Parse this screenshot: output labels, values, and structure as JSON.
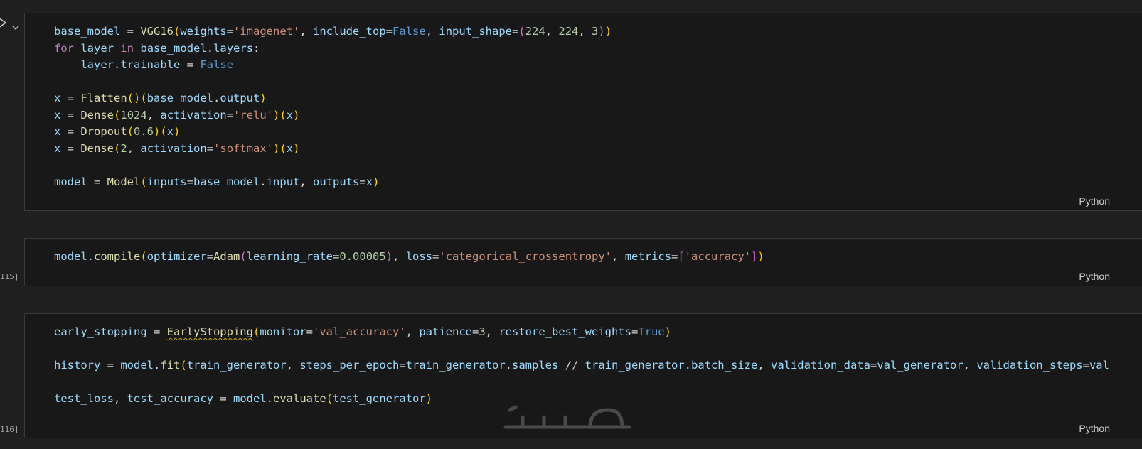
{
  "cells": [
    {
      "exec_count": "",
      "language": "Python",
      "lines": [
        [
          [
            "v",
            "base_model"
          ],
          [
            "o",
            " = "
          ],
          [
            "f",
            "VGG16"
          ],
          [
            "p1",
            "("
          ],
          [
            "v",
            "weights"
          ],
          [
            "o",
            "="
          ],
          [
            "s",
            "'imagenet'"
          ],
          [
            "o",
            ", "
          ],
          [
            "v",
            "include_top"
          ],
          [
            "o",
            "="
          ],
          [
            "b",
            "False"
          ],
          [
            "o",
            ", "
          ],
          [
            "v",
            "input_shape"
          ],
          [
            "o",
            "="
          ],
          [
            "p2",
            "("
          ],
          [
            "n",
            "224"
          ],
          [
            "o",
            ", "
          ],
          [
            "n",
            "224"
          ],
          [
            "o",
            ", "
          ],
          [
            "n",
            "3"
          ],
          [
            "p2",
            ")"
          ],
          [
            "p1",
            ")"
          ]
        ],
        [
          [
            "k",
            "for"
          ],
          [
            "o",
            " "
          ],
          [
            "v",
            "layer"
          ],
          [
            "o",
            " "
          ],
          [
            "k",
            "in"
          ],
          [
            "o",
            " "
          ],
          [
            "v",
            "base_model"
          ],
          [
            "o",
            "."
          ],
          [
            "v",
            "layers"
          ],
          [
            "o",
            ":"
          ]
        ],
        [
          [
            "o",
            "    "
          ],
          [
            "v",
            "layer"
          ],
          [
            "o",
            "."
          ],
          [
            "v",
            "trainable"
          ],
          [
            "o",
            " = "
          ],
          [
            "b",
            "False"
          ]
        ],
        [],
        [
          [
            "v",
            "x"
          ],
          [
            "o",
            " = "
          ],
          [
            "f",
            "Flatten"
          ],
          [
            "p1",
            "()"
          ],
          [
            "p1",
            "("
          ],
          [
            "v",
            "base_model"
          ],
          [
            "o",
            "."
          ],
          [
            "v",
            "output"
          ],
          [
            "p1",
            ")"
          ]
        ],
        [
          [
            "v",
            "x"
          ],
          [
            "o",
            " = "
          ],
          [
            "f",
            "Dense"
          ],
          [
            "p1",
            "("
          ],
          [
            "n",
            "1024"
          ],
          [
            "o",
            ", "
          ],
          [
            "v",
            "activation"
          ],
          [
            "o",
            "="
          ],
          [
            "s",
            "'relu'"
          ],
          [
            "p1",
            ")"
          ],
          [
            "p1",
            "("
          ],
          [
            "v",
            "x"
          ],
          [
            "p1",
            ")"
          ]
        ],
        [
          [
            "v",
            "x"
          ],
          [
            "o",
            " = "
          ],
          [
            "f",
            "Dropout"
          ],
          [
            "p1",
            "("
          ],
          [
            "n",
            "0.6"
          ],
          [
            "p1",
            ")"
          ],
          [
            "p1",
            "("
          ],
          [
            "v",
            "x"
          ],
          [
            "p1",
            ")"
          ]
        ],
        [
          [
            "v",
            "x"
          ],
          [
            "o",
            " = "
          ],
          [
            "f",
            "Dense"
          ],
          [
            "p1",
            "("
          ],
          [
            "n",
            "2"
          ],
          [
            "o",
            ", "
          ],
          [
            "v",
            "activation"
          ],
          [
            "o",
            "="
          ],
          [
            "s",
            "'softmax'"
          ],
          [
            "p1",
            ")"
          ],
          [
            "p1",
            "("
          ],
          [
            "v",
            "x"
          ],
          [
            "p1",
            ")"
          ]
        ],
        [],
        [
          [
            "v",
            "model"
          ],
          [
            "o",
            " = "
          ],
          [
            "f",
            "Model"
          ],
          [
            "p1",
            "("
          ],
          [
            "v",
            "inputs"
          ],
          [
            "o",
            "="
          ],
          [
            "v",
            "base_model"
          ],
          [
            "o",
            "."
          ],
          [
            "v",
            "input"
          ],
          [
            "o",
            ", "
          ],
          [
            "v",
            "outputs"
          ],
          [
            "o",
            "="
          ],
          [
            "v",
            "x"
          ],
          [
            "p1",
            ")"
          ]
        ]
      ]
    },
    {
      "exec_count": "115]",
      "language": "Python",
      "lines": [
        [
          [
            "v",
            "model"
          ],
          [
            "o",
            "."
          ],
          [
            "f",
            "compile"
          ],
          [
            "p1",
            "("
          ],
          [
            "v",
            "optimizer"
          ],
          [
            "o",
            "="
          ],
          [
            "f",
            "Adam"
          ],
          [
            "p2",
            "("
          ],
          [
            "v",
            "learning_rate"
          ],
          [
            "o",
            "="
          ],
          [
            "n",
            "0.00005"
          ],
          [
            "p2",
            ")"
          ],
          [
            "o",
            ", "
          ],
          [
            "v",
            "loss"
          ],
          [
            "o",
            "="
          ],
          [
            "s",
            "'categorical_crossentropy'"
          ],
          [
            "o",
            ", "
          ],
          [
            "v",
            "metrics"
          ],
          [
            "o",
            "="
          ],
          [
            "p2",
            "["
          ],
          [
            "s",
            "'accuracy'"
          ],
          [
            "p2",
            "]"
          ],
          [
            "p1",
            ")"
          ]
        ]
      ]
    },
    {
      "exec_count": "116]",
      "language": "Python",
      "lines": [
        [
          [
            "v",
            "early_stopping"
          ],
          [
            "o",
            " = "
          ],
          [
            "fw",
            "EarlyStopping"
          ],
          [
            "p1",
            "("
          ],
          [
            "v",
            "monitor"
          ],
          [
            "o",
            "="
          ],
          [
            "s",
            "'val_accuracy'"
          ],
          [
            "o",
            ", "
          ],
          [
            "v",
            "patience"
          ],
          [
            "o",
            "="
          ],
          [
            "n",
            "3"
          ],
          [
            "o",
            ", "
          ],
          [
            "v",
            "restore_best_weights"
          ],
          [
            "o",
            "="
          ],
          [
            "b",
            "True"
          ],
          [
            "p1",
            ")"
          ]
        ],
        [],
        [
          [
            "v",
            "history"
          ],
          [
            "o",
            " = "
          ],
          [
            "v",
            "model"
          ],
          [
            "o",
            "."
          ],
          [
            "f",
            "fit"
          ],
          [
            "p1",
            "("
          ],
          [
            "v",
            "train_generator"
          ],
          [
            "o",
            ", "
          ],
          [
            "v",
            "steps_per_epoch"
          ],
          [
            "o",
            "="
          ],
          [
            "v",
            "train_generator"
          ],
          [
            "o",
            "."
          ],
          [
            "v",
            "samples"
          ],
          [
            "o",
            " // "
          ],
          [
            "v",
            "train_generator"
          ],
          [
            "o",
            "."
          ],
          [
            "v",
            "batch_size"
          ],
          [
            "o",
            ", "
          ],
          [
            "v",
            "validation_data"
          ],
          [
            "o",
            "="
          ],
          [
            "v",
            "val_generator"
          ],
          [
            "o",
            ", "
          ],
          [
            "v",
            "validation_steps"
          ],
          [
            "o",
            "="
          ],
          [
            "v",
            "val"
          ]
        ],
        [],
        [
          [
            "v",
            "test_loss"
          ],
          [
            "o",
            ", "
          ],
          [
            "v",
            "test_accuracy"
          ],
          [
            "o",
            " = "
          ],
          [
            "v",
            "model"
          ],
          [
            "o",
            "."
          ],
          [
            "f",
            "evaluate"
          ],
          [
            "p1",
            "("
          ],
          [
            "v",
            "test_generator"
          ],
          [
            "p1",
            ")"
          ]
        ]
      ]
    }
  ],
  "watermark": "خ‌ستات"
}
